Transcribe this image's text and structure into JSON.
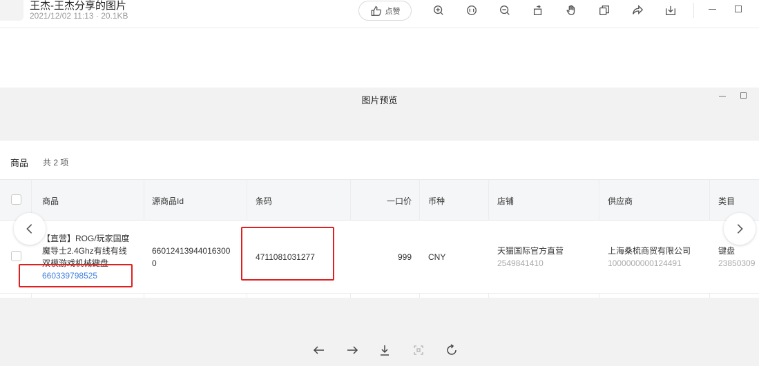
{
  "topbar": {
    "file_title": "王杰-王杰分享的图片",
    "file_meta": "2021/12/02 11:13 · 20.1KB",
    "like_label": "点赞",
    "icons": [
      "zoom-in-icon",
      "actual-size-icon",
      "zoom-out-icon",
      "rotate-icon",
      "hand-icon",
      "copy-icon",
      "share-icon",
      "download-icon"
    ]
  },
  "preview": {
    "title": "图片预览"
  },
  "section": {
    "label": "商品",
    "count": "共 2 项"
  },
  "table": {
    "headers": {
      "product": "商品",
      "source_id": "源商品Id",
      "barcode": "条码",
      "price": "一口价",
      "currency": "币种",
      "store": "店铺",
      "supplier": "供应商",
      "category": "类目"
    },
    "row": {
      "product_line1": "【直营】ROG/玩家国度",
      "product_line2": "魔导士2.4Ghz有线有线",
      "product_line3": "双模游戏机械键盘",
      "product_id": "660339798525",
      "source_id_line1": "66012413944016300",
      "source_id_line2": "0",
      "barcode": "4711081031277",
      "price": "999",
      "currency": "CNY",
      "store_name": "天猫国际官方直营",
      "store_id": "2549841410",
      "supplier_name": "上海桑梳商贸有限公司",
      "supplier_id": "1000000000124491",
      "category_name": "键盘",
      "category_id": "23850309"
    }
  },
  "colors": {
    "highlight": "#e02020",
    "link": "#3d7fe0",
    "preview_bg": "#f2f2f2"
  }
}
